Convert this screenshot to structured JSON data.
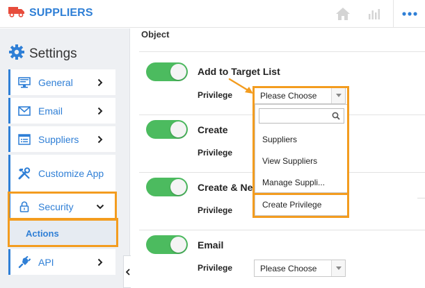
{
  "header": {
    "title": "SUPPLIERS",
    "icons": [
      "truck-icon",
      "home-icon",
      "bar-chart-icon",
      "more-icon"
    ]
  },
  "sidebar": {
    "heading": "Settings",
    "items": [
      {
        "label": "General",
        "icon": "monitor-icon"
      },
      {
        "label": "Email",
        "icon": "envelope-icon"
      },
      {
        "label": "Suppliers",
        "icon": "list-window-icon"
      },
      {
        "label": "Customize App",
        "icon": "tools-icon"
      },
      {
        "label": "Security",
        "icon": "lock-icon"
      },
      {
        "label": "Actions"
      },
      {
        "label": "API",
        "icon": "plug-icon"
      }
    ]
  },
  "main": {
    "section_title": "Object",
    "privilege_label": "Privilege",
    "rows": [
      {
        "title": "Add to Target List",
        "privilege": "Please Choose"
      },
      {
        "title": "Create",
        "privilege": ""
      },
      {
        "title": "Create & Ne",
        "privilege": ""
      },
      {
        "title": "Email",
        "privilege": "Please Choose"
      }
    ]
  },
  "dropdown": {
    "search_placeholder": "",
    "options": [
      "Suppliers",
      "View Suppliers",
      "Manage Suppli...",
      "Create Privilege"
    ]
  },
  "colors": {
    "brand": "#2f7fd6",
    "toggle_on": "#4cbb5f",
    "highlight": "#f39c1f",
    "truck": "#e74c3c"
  }
}
